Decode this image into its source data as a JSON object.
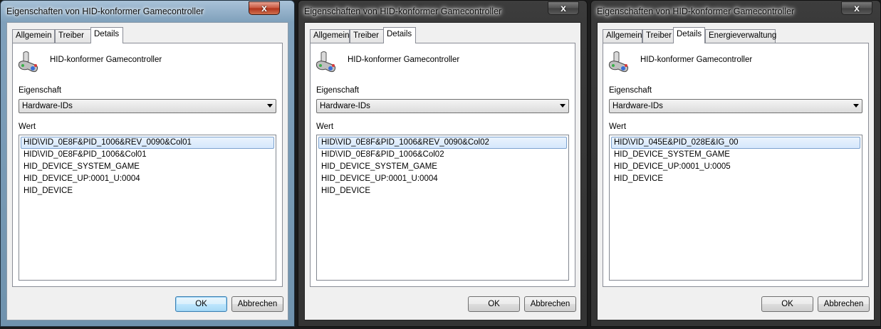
{
  "windows": [
    {
      "title": "Eigenschaften von HID-konformer Gamecontroller",
      "close_label": "x",
      "tabs": [
        {
          "label": "Allgemein",
          "active": false
        },
        {
          "label": "Treiber",
          "active": false
        },
        {
          "label": "Details",
          "active": true
        }
      ],
      "device_name": "HID-konformer Gamecontroller",
      "device_icon": "gamecontroller-icon",
      "property_label": "Eigenschaft",
      "property_value": "Hardware-IDs",
      "value_label": "Wert",
      "values": [
        "HID\\VID_0E8F&PID_1006&REV_0090&Col01",
        "HID\\VID_0E8F&PID_1006&Col01",
        "HID_DEVICE_SYSTEM_GAME",
        "HID_DEVICE_UP:0001_U:0004",
        "HID_DEVICE"
      ],
      "ok_label": "OK",
      "cancel_label": "Abbrechen"
    },
    {
      "title": "Eigenschaften von HID-konformer Gamecontroller",
      "close_label": "x",
      "tabs": [
        {
          "label": "Allgemein",
          "active": false
        },
        {
          "label": "Treiber",
          "active": false
        },
        {
          "label": "Details",
          "active": true
        }
      ],
      "device_name": "HID-konformer Gamecontroller",
      "device_icon": "gamecontroller-icon",
      "property_label": "Eigenschaft",
      "property_value": "Hardware-IDs",
      "value_label": "Wert",
      "values": [
        "HID\\VID_0E8F&PID_1006&REV_0090&Col02",
        "HID\\VID_0E8F&PID_1006&Col02",
        "HID_DEVICE_SYSTEM_GAME",
        "HID_DEVICE_UP:0001_U:0004",
        "HID_DEVICE"
      ],
      "ok_label": "OK",
      "cancel_label": "Abbrechen"
    },
    {
      "title": "Eigenschaften von HID-konformer Gamecontroller",
      "close_label": "x",
      "tabs": [
        {
          "label": "Allgemein",
          "active": false
        },
        {
          "label": "Treiber",
          "active": false
        },
        {
          "label": "Details",
          "active": true
        },
        {
          "label": "Energieverwaltung",
          "active": false
        }
      ],
      "device_name": "HID-konformer Gamecontroller",
      "device_icon": "gamecontroller-icon",
      "property_label": "Eigenschaft",
      "property_value": "Hardware-IDs",
      "value_label": "Wert",
      "values": [
        "HID\\VID_045E&PID_028E&IG_00",
        "HID_DEVICE_SYSTEM_GAME",
        "HID_DEVICE_UP:0001_U:0005",
        "HID_DEVICE"
      ],
      "ok_label": "OK",
      "cancel_label": "Abbrechen"
    }
  ]
}
